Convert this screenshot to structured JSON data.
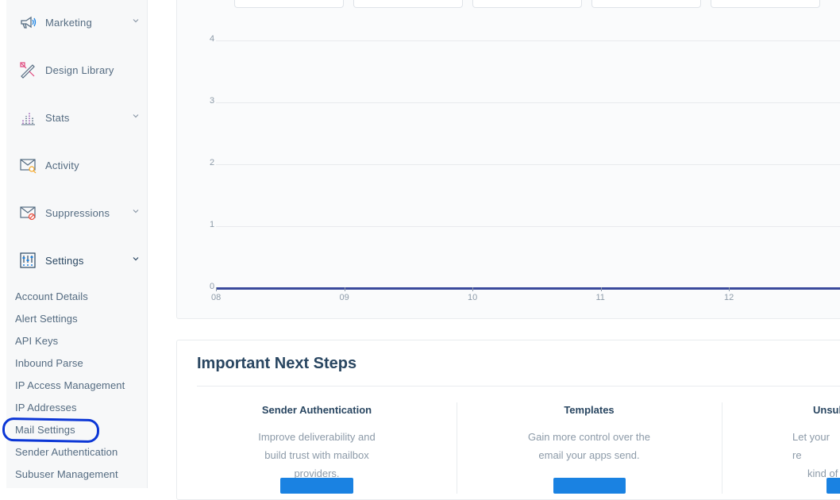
{
  "sidebar": {
    "items": [
      {
        "label": "Marketing",
        "icon": "megaphone-icon",
        "has_chevron": true
      },
      {
        "label": "Design Library",
        "icon": "design-tools-icon",
        "has_chevron": false
      },
      {
        "label": "Stats",
        "icon": "bar-stats-icon",
        "has_chevron": true
      },
      {
        "label": "Activity",
        "icon": "envelope-search-icon",
        "has_chevron": false
      },
      {
        "label": "Suppressions",
        "icon": "envelope-block-icon",
        "has_chevron": true
      },
      {
        "label": "Settings",
        "icon": "sliders-icon",
        "has_chevron": true,
        "expanded": true
      }
    ],
    "settings_subitems": [
      "Account Details",
      "Alert Settings",
      "API Keys",
      "Inbound Parse",
      "IP Access Management",
      "IP Addresses",
      "Mail Settings",
      "Sender Authentication",
      "Subuser Management"
    ],
    "highlighted_item": "Mail Settings",
    "highlight_color": "#0b36d6"
  },
  "chart_data": {
    "type": "line",
    "x": [
      "08",
      "09",
      "10",
      "11",
      "12"
    ],
    "series": [
      {
        "values": [
          0,
          0,
          0,
          0,
          0
        ]
      }
    ],
    "y_ticks": [
      "0",
      "1",
      "2",
      "3",
      "4"
    ],
    "ylim": [
      0,
      4
    ],
    "grid": true,
    "line_color": "#3a4a9c"
  },
  "next_steps": {
    "title": "Important Next Steps",
    "cards": [
      {
        "title": "Sender Authentication",
        "desc_lines": [
          "Improve deliverability and",
          "build trust with mailbox",
          "providers."
        ]
      },
      {
        "title": "Templates",
        "desc_lines": [
          "Gain more control over the",
          "email your apps send."
        ]
      },
      {
        "title": "Unsul",
        "desc_lines": [
          "Let your re",
          "kind of"
        ]
      }
    ],
    "button_color": "#1a82e2"
  }
}
